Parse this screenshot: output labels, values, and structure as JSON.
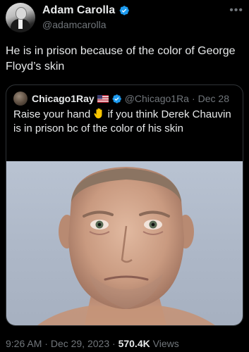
{
  "author": {
    "name": "Adam Carolla",
    "handle": "@adamcarolla"
  },
  "more_icon": "•••",
  "tweet": {
    "text": "He is in prison because of the color of George Floyd’s skin"
  },
  "quoted_tweet": {
    "name": "Chicago1Ray",
    "flag_icon": "us-flag-icon",
    "handle": "@Chicago1Ra",
    "separator": "·",
    "date": "Dec 28",
    "text_before_emoji": "Raise your hand ",
    "emoji_icon": "raised-hand-icon",
    "text_after_emoji": " if you think Derek Chauvin is in prison bc of the color of his skin",
    "image_icon": "mugshot-photo"
  },
  "footer": {
    "time": "9:26 AM",
    "separator1": " · ",
    "date": "Dec 29, 2023",
    "separator2": " · ",
    "views_count": "570.4K",
    "views_label": " Views"
  },
  "colors": {
    "background": "#000000",
    "text": "#e7e9ea",
    "muted": "#71767b",
    "verified": "#1d9bf0",
    "border": "#2f3336"
  }
}
